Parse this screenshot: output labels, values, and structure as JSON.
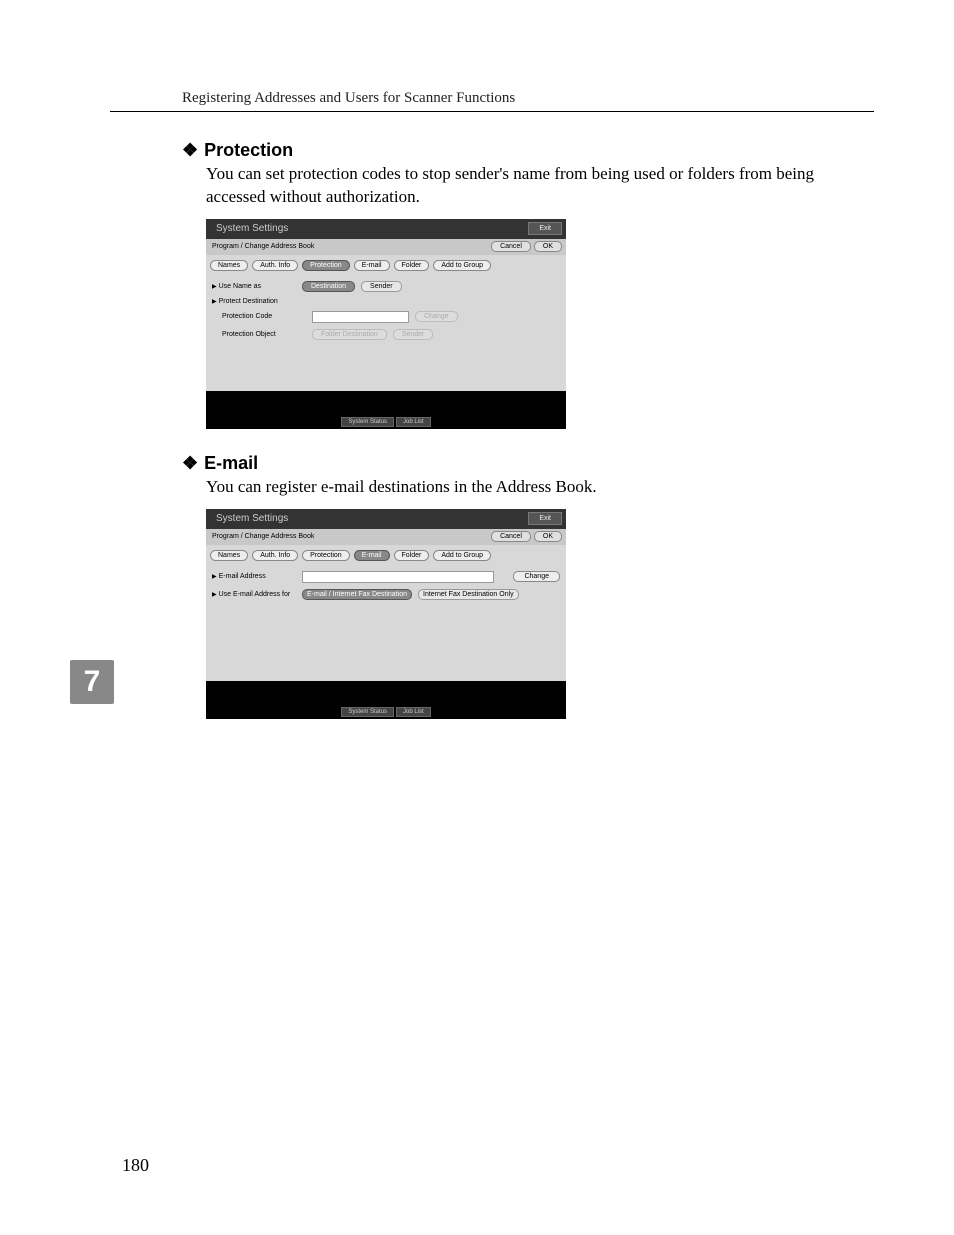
{
  "header": "Registering Addresses and Users for Scanner Functions",
  "chapter_number": "7",
  "page_number": "180",
  "sections": [
    {
      "heading": "Protection",
      "text": "You can set protection codes to stop sender's name from being used or folders from being accessed without authorization.",
      "screenshot": {
        "title": "System Settings",
        "exit": "Exit",
        "subtitle": "Program / Change Address Book",
        "cancel": "Cancel",
        "ok": "OK",
        "tabs": [
          "Names",
          "Auth. Info",
          "Protection",
          "E-mail",
          "Folder",
          "Add to Group"
        ],
        "active_tab_index": 2,
        "rows": {
          "use_name_as": {
            "label": "Use Name as",
            "buttons": [
              "Destination",
              "Sender"
            ],
            "active": 0
          },
          "protect_dest": {
            "label": "Protect Destination"
          },
          "protection_code": {
            "label": "Protection Code",
            "change": "Change"
          },
          "protection_object": {
            "label": "Protection Object",
            "buttons": [
              "Folder Destination",
              "Sender"
            ]
          }
        },
        "footer": [
          "System Status",
          "Job List"
        ]
      }
    },
    {
      "heading": "E-mail",
      "text": "You can register e-mail destinations in the Address Book.",
      "screenshot": {
        "title": "System Settings",
        "exit": "Exit",
        "subtitle": "Program / Change Address Book",
        "cancel": "Cancel",
        "ok": "OK",
        "tabs": [
          "Names",
          "Auth. Info",
          "Protection",
          "E-mail",
          "Folder",
          "Add to Group"
        ],
        "active_tab_index": 3,
        "rows": {
          "email_address": {
            "label": "E-mail Address",
            "change": "Change"
          },
          "use_email_for": {
            "label": "Use E-mail Address for",
            "buttons": [
              "E-mail / Internet Fax Destination",
              "Internet Fax Destination Only"
            ],
            "active": 0
          }
        },
        "footer": [
          "System Status",
          "Job List"
        ]
      }
    }
  ]
}
